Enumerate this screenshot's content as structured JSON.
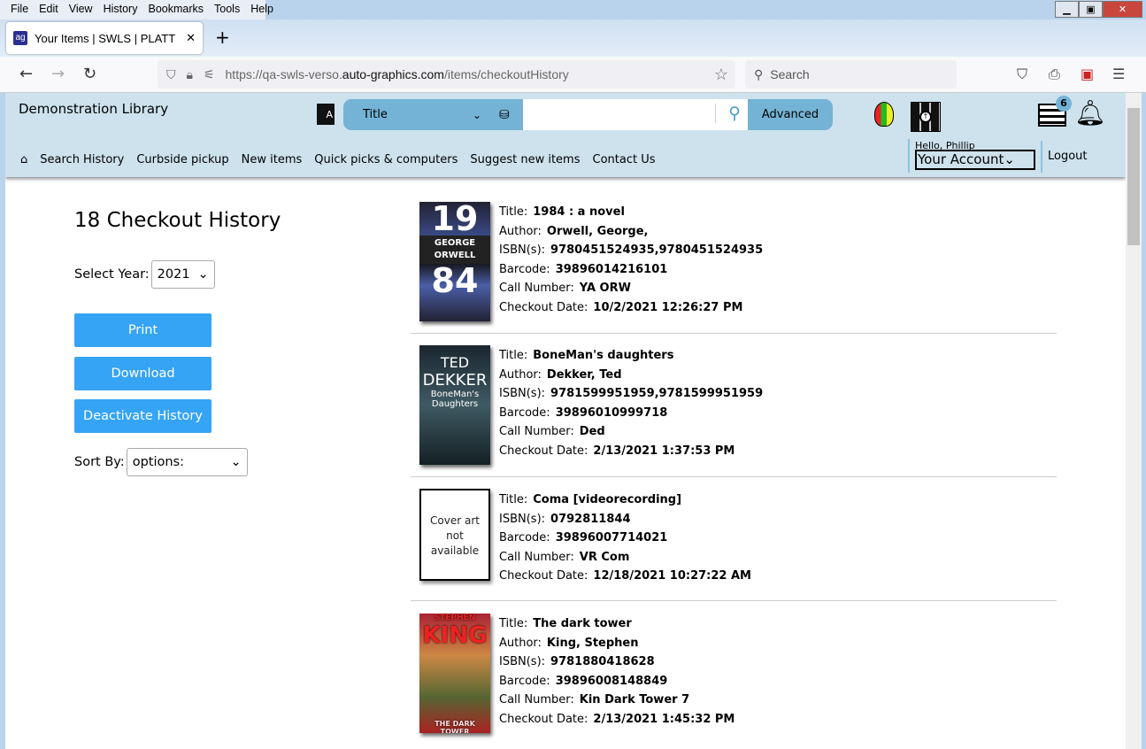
{
  "browser": {
    "menu": [
      "File",
      "Edit",
      "View",
      "History",
      "Bookmarks",
      "Tools",
      "Help"
    ],
    "tab_title": "Your Items | SWLS | PLATT | Auto-Graphics",
    "url_prefix": "https://qa-swls-verso.",
    "url_domain": "auto-graphics.com",
    "url_path": "/items/checkoutHistory",
    "search_placeholder": "Search"
  },
  "header": {
    "library_name": "Demonstration Library",
    "search_type": "Title",
    "search_value": "",
    "advanced_label": "Advanced",
    "list_badge": "6",
    "nav": [
      "Search History",
      "Curbside pickup",
      "New items",
      "Quick picks & computers",
      "Suggest new items",
      "Contact Us"
    ],
    "greeting": "Hello, Phillip",
    "account_label": "Your Account",
    "logout_label": "Logout"
  },
  "sidebar": {
    "heading": "18 Checkout History",
    "year_label": "Select Year:",
    "year_value": "2021",
    "print_label": "Print",
    "download_label": "Download",
    "deactivate_label": "Deactivate History",
    "sort_label": "Sort By:",
    "sort_value": "options:"
  },
  "items": [
    {
      "cover_text": [
        "19",
        "GEORGE ORWELL",
        "84"
      ],
      "fields": [
        [
          "Title:",
          "1984 : a novel"
        ],
        [
          "Author:",
          "Orwell, George,"
        ],
        [
          "ISBN(s):",
          "9780451524935,9780451524935"
        ],
        [
          "Barcode:",
          "39896014216101"
        ],
        [
          "Call Number:",
          "YA ORW"
        ],
        [
          "Checkout Date:",
          "10/2/2021 12:26:27 PM"
        ]
      ]
    },
    {
      "cover_text": [
        "TED",
        "DEKKER",
        "BoneMan's Daughters"
      ],
      "fields": [
        [
          "Title:",
          "BoneMan's daughters"
        ],
        [
          "Author:",
          "Dekker, Ted"
        ],
        [
          "ISBN(s):",
          "9781599951959,9781599951959"
        ],
        [
          "Barcode:",
          "39896010999718"
        ],
        [
          "Call Number:",
          "Ded"
        ],
        [
          "Checkout Date:",
          "2/13/2021 1:37:53 PM"
        ]
      ]
    },
    {
      "cover_text": [
        "Cover art not available"
      ],
      "fields": [
        [
          "Title:",
          "Coma [videorecording]"
        ],
        [
          "ISBN(s):",
          "0792811844"
        ],
        [
          "Barcode:",
          "39896007714021"
        ],
        [
          "Call Number:",
          "VR Com"
        ],
        [
          "Checkout Date:",
          "12/18/2021 10:27:22 AM"
        ]
      ]
    },
    {
      "cover_text": [
        "STEPHEN",
        "KING",
        "THE DARK TOWER"
      ],
      "fields": [
        [
          "Title:",
          "The dark tower"
        ],
        [
          "Author:",
          "King, Stephen"
        ],
        [
          "ISBN(s):",
          "9781880418628"
        ],
        [
          "Barcode:",
          "39896008148849"
        ],
        [
          "Call Number:",
          "Kin Dark Tower 7"
        ],
        [
          "Checkout Date:",
          "2/13/2021 1:45:32 PM"
        ]
      ]
    }
  ]
}
